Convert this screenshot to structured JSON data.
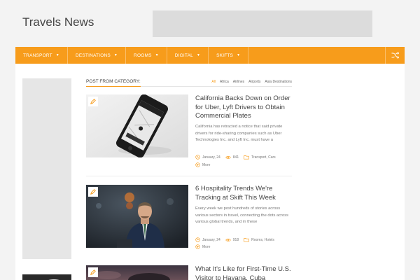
{
  "site": {
    "title": "Travels News"
  },
  "nav": {
    "items": [
      {
        "label": "Transport"
      },
      {
        "label": "Destinations"
      },
      {
        "label": "Rooms"
      },
      {
        "label": "Digital"
      },
      {
        "label": "Skifts"
      }
    ]
  },
  "category": {
    "title": "Post from category:",
    "tabs": [
      "All",
      "Africa",
      "Airlines",
      "Airports",
      "Asia Destinations"
    ]
  },
  "posts": [
    {
      "title": "California Backs Down on Order for Uber, Lyft Drivers to Obtain Commercial Plates",
      "excerpt": "California has retracted a notice that said private drivers for ride-sharing companies such as Uber Technologies Inc. and Lyft Inc. must have a",
      "date": "January, 24",
      "views": "841",
      "categories": "Transport, Cars",
      "more": "More"
    },
    {
      "title": "6 Hospitality Trends We're Tracking at Skift This Week",
      "excerpt": "Every week we post hundreds of stories across various sectors in travel, connecting the dots across various global trends, and in these",
      "date": "January, 24",
      "views": "918",
      "categories": "Rooms, Hotels",
      "more": "More"
    },
    {
      "title": "What It's Like for First-Time U.S. Visitor to Havana, Cuba"
    }
  ],
  "colors": {
    "accent": "#f79c1b",
    "placeholder": "#dcdcdc"
  }
}
